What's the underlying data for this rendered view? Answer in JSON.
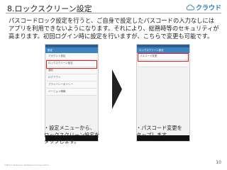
{
  "slide": {
    "title": "8.ロックスクリーン設定",
    "logo": "クラウド",
    "body_lines": [
      "パスコードロック設定を行うと、ご自身で設定したパスコードの入力なしには",
      "アプリを利用できないようになります。それにより、総務時等のセキュリティが",
      "高まります。初回ログイン時に設定を行いますが、こちらで変更も可能です。"
    ],
    "left_caption_lines": [
      "・設定メニューから、",
      "ロックスクリーン設定を",
      "タップします。"
    ],
    "right_caption_lines": [
      "・パスコード変更を",
      "タップします。"
    ],
    "copyright": "©Nihon Business Intelligence Corporation",
    "page_number": "10"
  },
  "left_phone": {
    "appbar_title": "設定",
    "items": [
      "アカウント設定",
      "ロックスクリーン設定",
      "通知",
      "ログアウト",
      "プライバシーポリシー",
      "バージョン情報"
    ],
    "highlighted_index": 1
  },
  "right_phone": {
    "appbar_title": "ロックスクリーン設定",
    "items": [
      "パスコード変更",
      ""
    ],
    "highlighted_index": 0
  },
  "colors": {
    "accent": "#3d84c0",
    "highlight": "#e11d1d"
  }
}
